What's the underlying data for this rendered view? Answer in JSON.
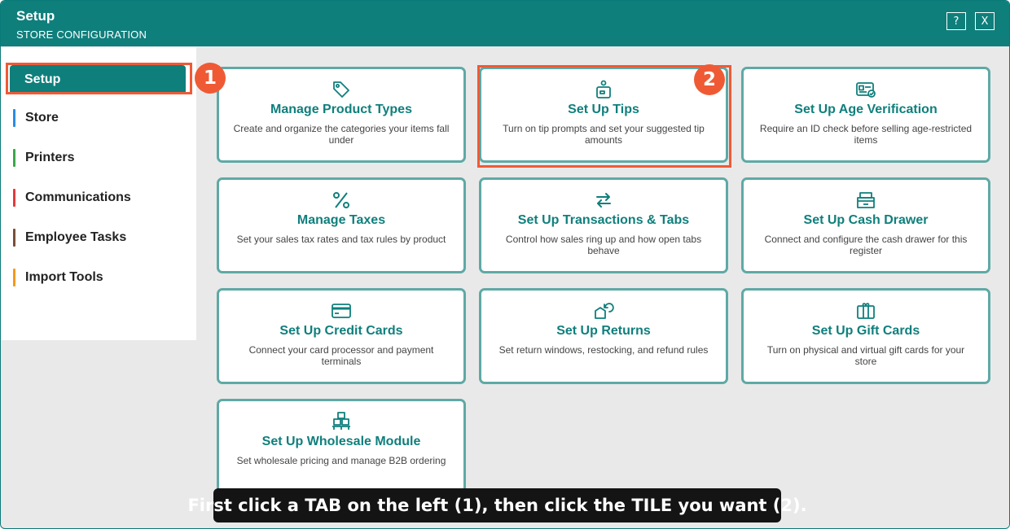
{
  "window": {
    "title": "Setup",
    "subtitle": "STORE CONFIGURATION",
    "help_button": "?",
    "close_button": "X"
  },
  "sidebar": {
    "items": [
      {
        "label": "Setup",
        "accent": "#0f7f7c",
        "active": true
      },
      {
        "label": "Store",
        "accent": "#2b8be6"
      },
      {
        "label": "Printers",
        "accent": "#3aa84a"
      },
      {
        "label": "Communications",
        "accent": "#e23b3b"
      },
      {
        "label": "Employee Tasks",
        "accent": "#7a4f3a"
      },
      {
        "label": "Import Tools",
        "accent": "#f39a1e"
      }
    ]
  },
  "callouts": {
    "one": "1",
    "two": "2"
  },
  "tiles": [
    {
      "title": "Manage Product Types",
      "description": "Create and organize the categories your items fall under",
      "icon": "tag-icon"
    },
    {
      "title": "Set Up Tips",
      "description": "Turn on tip prompts and set your suggested tip amounts",
      "icon": "tip-jar-icon"
    },
    {
      "title": "Set Up Age Verification",
      "description": "Require an ID check before selling age-restricted items",
      "icon": "id-card-icon"
    },
    {
      "title": "Manage Taxes",
      "description": "Set your sales tax rates and tax rules by product",
      "icon": "percent-icon"
    },
    {
      "title": "Set Up Transactions & Tabs",
      "description": "Control how sales ring up and how open tabs behave",
      "icon": "swap-arrows-icon"
    },
    {
      "title": "Set Up Cash Drawer",
      "description": "Connect and configure the cash drawer for this register",
      "icon": "cash-drawer-icon"
    },
    {
      "title": "Set Up Credit Cards",
      "description": "Connect your card processor and payment terminals",
      "icon": "credit-card-icon"
    },
    {
      "title": "Set Up Returns",
      "description": "Set return windows, restocking, and refund rules",
      "icon": "return-box-icon"
    },
    {
      "title": "Set Up Gift Cards",
      "description": "Turn on physical and virtual gift cards for your store",
      "icon": "gift-icon"
    },
    {
      "title": "Set Up Wholesale Module",
      "description": "Set wholesale pricing and manage B2B ordering",
      "icon": "pallet-boxes-icon"
    }
  ],
  "banner": {
    "text": "First click a TAB on the left (1), then click the TILE you want (2)."
  },
  "colors": {
    "brand": "#0f7f7c",
    "callout": "#ef5a35",
    "tile_border": "#5fa9a5"
  }
}
